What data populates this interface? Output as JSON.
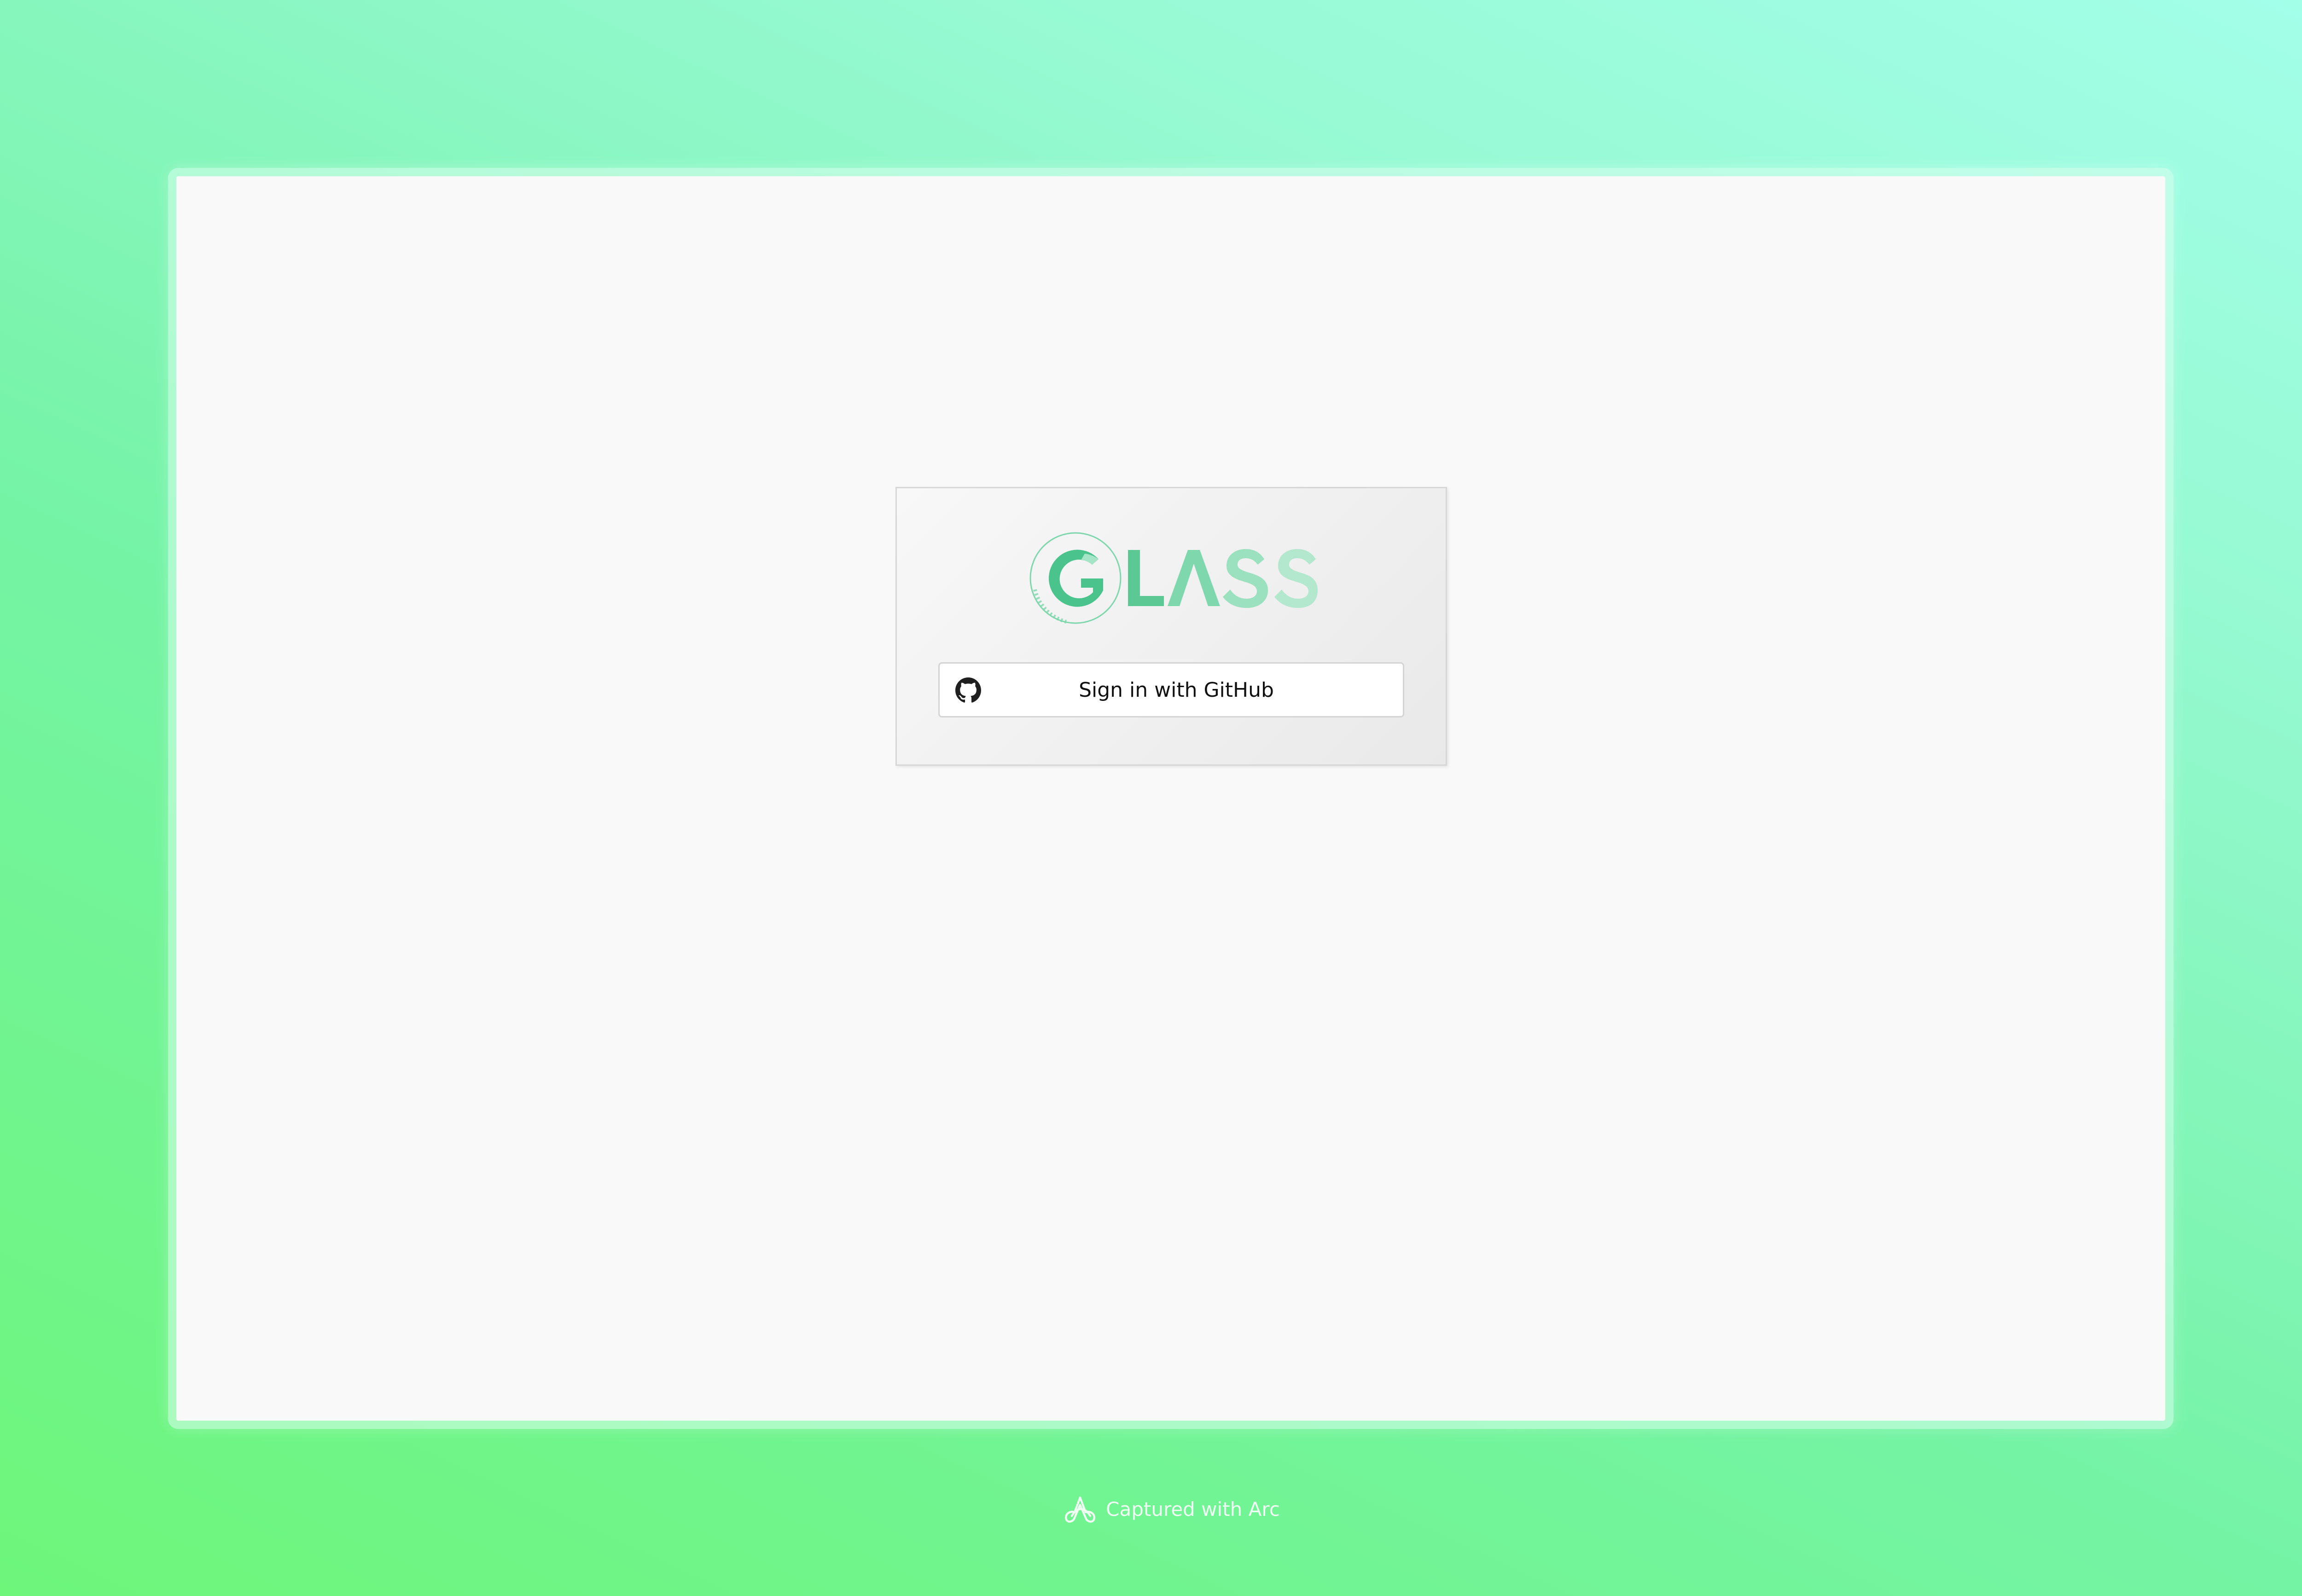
{
  "login": {
    "logo_text": "GLASS",
    "logo_ring_text": "BETA CODE",
    "signin_label": "Sign in with GitHub"
  },
  "footer": {
    "label": "Captured with Arc"
  },
  "colors": {
    "brand_primary": "#5cc994",
    "brand_light": "#a8e3c6",
    "window_background": "#f9f9f9"
  },
  "icons": {
    "signin": "github-icon",
    "footer": "arc-icon"
  }
}
